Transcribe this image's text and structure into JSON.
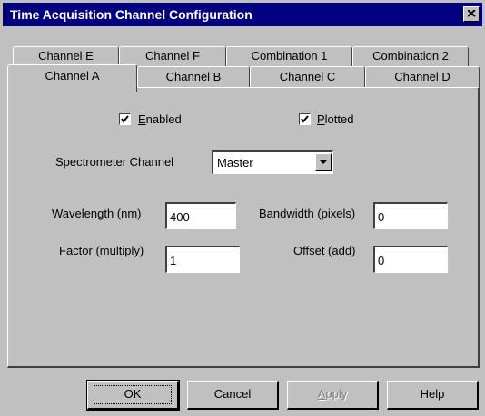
{
  "window": {
    "title": "Time Acquisition Channel Configuration"
  },
  "tabs": {
    "back_row": [
      "Channel E",
      "Channel F",
      "Combination 1",
      "Combination 2"
    ],
    "front_row": [
      "Channel A",
      "Channel B",
      "Channel C",
      "Channel D"
    ],
    "active": "Channel A"
  },
  "panel": {
    "enabled": {
      "label": "Enabled",
      "mnemonic": "E",
      "rest": "nabled",
      "checked": true
    },
    "plotted": {
      "label": "Plotted",
      "mnemonic": "P",
      "rest": "lotted",
      "checked": true
    },
    "spectrometer_label": "Spectrometer Channel",
    "spectrometer_value": "Master",
    "wavelength_label": "Wavelength (nm)",
    "wavelength_value": "400",
    "bandwidth_label": "Bandwidth (pixels)",
    "bandwidth_value": "0",
    "factor_label": "Factor (multiply)",
    "factor_value": "1",
    "offset_label": "Offset (add)",
    "offset_value": "0"
  },
  "buttons": {
    "ok": "OK",
    "cancel": "Cancel",
    "apply": "Apply",
    "apply_mnemonic": "A",
    "apply_rest": "pply",
    "help": "Help"
  },
  "colors": {
    "titlebar": "#000080",
    "face": "#c0c0c0",
    "disabled_text": "#808080"
  }
}
